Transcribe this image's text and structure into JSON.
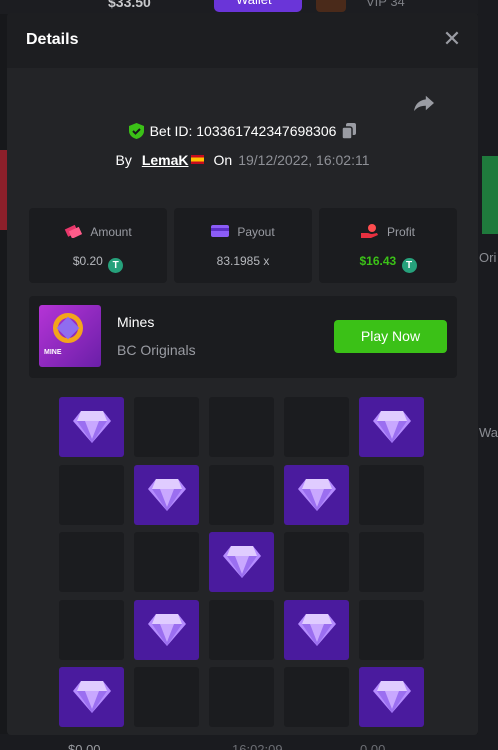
{
  "background": {
    "top_amount": "$33.50",
    "wallet_label": "Wallet",
    "vip_label": "VIP 34",
    "right_text_1": "Ori",
    "right_text_2": "Wa",
    "bottom_amount": "$0.00",
    "bottom_time": "16:02:09",
    "bottom_value": "0.00"
  },
  "modal": {
    "title": "Details",
    "close_icon": "close-icon",
    "share_icon": "share-icon"
  },
  "bet": {
    "id_label": "Bet ID: 103361742347698306",
    "by_label": "By",
    "username": "LemaK",
    "on_label": "On",
    "datetime": "19/12/2022, 16:02:11"
  },
  "stats": {
    "amount": {
      "label": "Amount",
      "value": "$0.20",
      "icon": "money-stack-icon"
    },
    "payout": {
      "label": "Payout",
      "value": "83.1985 x",
      "icon": "card-icon"
    },
    "profit": {
      "label": "Profit",
      "value": "$16.43",
      "icon": "hand-coin-icon"
    },
    "coin_symbol": "T"
  },
  "game": {
    "name": "Mines",
    "provider": "BC Originals",
    "thumb_label": "MINE",
    "play_label": "Play Now"
  },
  "colors": {
    "accent_green": "#3bc117",
    "gem_tile": "#4a1b9e",
    "tether": "#26a17b"
  },
  "mines_grid": {
    "rows": 5,
    "cols": 5,
    "tiles": [
      [
        "gem",
        "empty",
        "empty",
        "empty",
        "gem"
      ],
      [
        "empty",
        "gem",
        "empty",
        "gem",
        "empty"
      ],
      [
        "empty",
        "empty",
        "gem",
        "empty",
        "empty"
      ],
      [
        "empty",
        "gem",
        "empty",
        "gem",
        "empty"
      ],
      [
        "gem",
        "empty",
        "empty",
        "empty",
        "gem"
      ]
    ]
  }
}
